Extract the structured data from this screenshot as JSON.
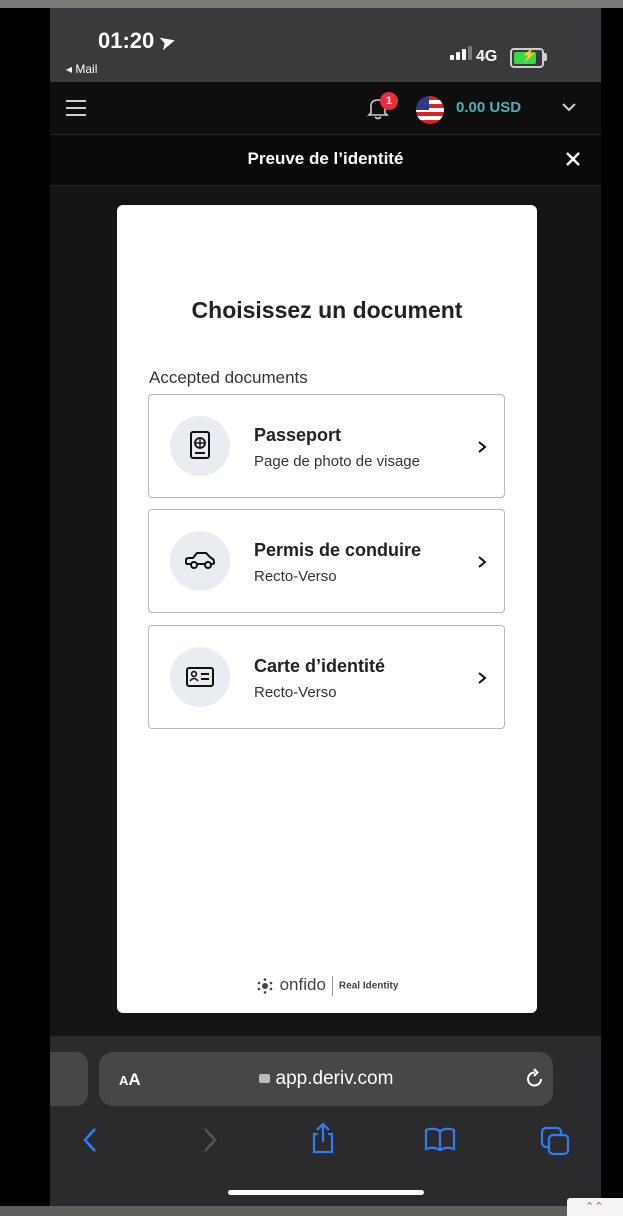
{
  "status_bar": {
    "time": "01:20",
    "back_app": "◂ Mail",
    "network": "4G"
  },
  "header": {
    "notification_count": "1",
    "balance": "0.00 USD"
  },
  "modal": {
    "title": "Preuve de l’identité"
  },
  "onfido": {
    "heading": "Choisissez un document",
    "section_label": "Accepted documents",
    "options": [
      {
        "name": "Passeport",
        "subtitle": "Page de photo de visage",
        "icon": "passport-icon"
      },
      {
        "name": "Permis de conduire",
        "subtitle": "Recto-Verso",
        "icon": "car-icon"
      },
      {
        "name": "Carte d’identité",
        "subtitle": "Recto-Verso",
        "icon": "id-card-icon"
      }
    ],
    "footer_brand": "onfido",
    "footer_tagline": "Real Identity"
  },
  "browser": {
    "text_size_small": "A",
    "text_size_large": "A",
    "url": "app.deriv.com"
  },
  "colors": {
    "balance": "#4bb4b3",
    "badge": "#e5303a",
    "safari_blue": "#2f7cf6",
    "battery": "#36d84c"
  },
  "corner_badge": "⌃⌃"
}
